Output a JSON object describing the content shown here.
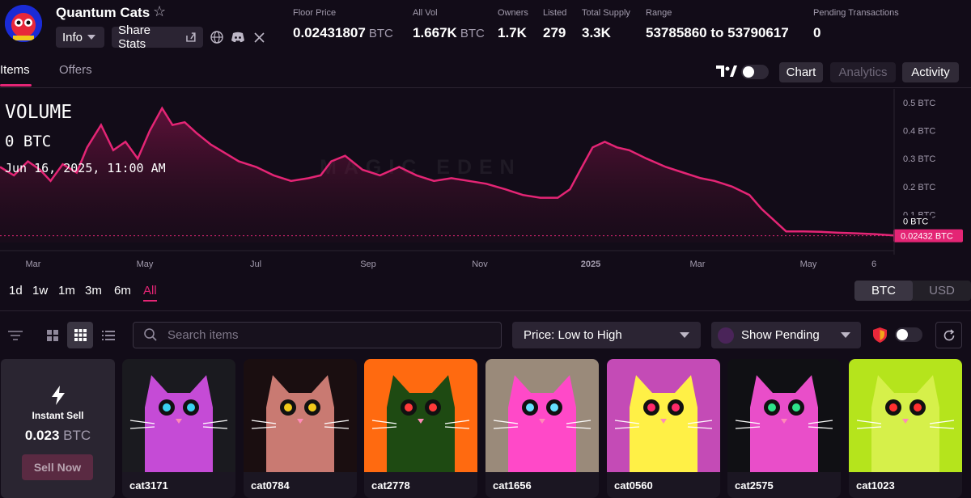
{
  "collection": {
    "name": "Quantum Cats",
    "info_label": "Info",
    "share_label": "Share Stats"
  },
  "stats": [
    {
      "label": "Floor Price",
      "value": "0.02431807",
      "unit": "BTC"
    },
    {
      "label": "All Vol",
      "value": "1.667K",
      "unit": "BTC"
    },
    {
      "label": "Owners",
      "value": "1.7K",
      "unit": ""
    },
    {
      "label": "Listed",
      "value": "279",
      "unit": ""
    },
    {
      "label": "Total Supply",
      "value": "3.3K",
      "unit": ""
    },
    {
      "label": "Range",
      "value": "53785860 to 53790617",
      "unit": ""
    },
    {
      "label": "Pending Transactions",
      "value": "0",
      "unit": ""
    }
  ],
  "tabs": {
    "items": "Items",
    "offers": "Offers"
  },
  "view_buttons": {
    "chart": "Chart",
    "analytics": "Analytics",
    "activity": "Activity"
  },
  "chart_header": {
    "title": "VOLUME",
    "value": "0 BTC",
    "date": "Jun 16, 2025, 11:00 AM"
  },
  "watermark": "MAGIC EDEN",
  "chart_data": {
    "type": "area",
    "series": [
      {
        "name": "",
        "x": [
          "2024-01-20",
          "2024-01-28",
          "2024-02-05",
          "2024-02-12",
          "2024-02-18",
          "2024-02-25",
          "2024-03-04",
          "2024-03-10",
          "2024-03-18",
          "2024-03-25",
          "2024-04-01",
          "2024-04-08",
          "2024-04-15",
          "2024-04-22",
          "2024-04-28",
          "2024-05-05",
          "2024-05-12",
          "2024-05-20",
          "2024-05-28",
          "2024-06-05",
          "2024-06-15",
          "2024-06-25",
          "2024-07-05",
          "2024-07-15",
          "2024-07-22",
          "2024-07-28",
          "2024-08-05",
          "2024-08-15",
          "2024-08-25",
          "2024-09-05",
          "2024-09-15",
          "2024-09-25",
          "2024-10-05",
          "2024-10-15",
          "2024-10-25",
          "2024-11-05",
          "2024-11-15",
          "2024-11-25",
          "2024-12-05",
          "2024-12-12",
          "2024-12-18",
          "2024-12-25",
          "2025-01-01",
          "2025-01-08",
          "2025-01-15",
          "2025-01-25",
          "2025-02-05",
          "2025-02-15",
          "2025-02-25",
          "2025-03-05",
          "2025-03-15",
          "2025-03-25",
          "2025-04-01",
          "2025-04-08",
          "2025-04-15",
          "2025-04-25",
          "2025-05-05",
          "2025-05-15",
          "2025-05-25",
          "2025-06-05",
          "2025-06-16"
        ],
        "values": [
          0.27,
          0.24,
          0.29,
          0.26,
          0.22,
          0.28,
          0.25,
          0.34,
          0.42,
          0.33,
          0.36,
          0.3,
          0.4,
          0.48,
          0.42,
          0.43,
          0.39,
          0.35,
          0.32,
          0.29,
          0.27,
          0.24,
          0.22,
          0.23,
          0.24,
          0.29,
          0.31,
          0.26,
          0.24,
          0.27,
          0.24,
          0.22,
          0.23,
          0.22,
          0.21,
          0.19,
          0.17,
          0.16,
          0.16,
          0.19,
          0.26,
          0.34,
          0.36,
          0.34,
          0.33,
          0.3,
          0.27,
          0.25,
          0.23,
          0.22,
          0.2,
          0.17,
          0.12,
          0.08,
          0.04,
          0.04,
          0.038,
          0.035,
          0.033,
          0.03,
          0.025
        ]
      }
    ],
    "xticks": [
      "Mar",
      "May",
      "Jul",
      "Sep",
      "Nov",
      "2025",
      "Mar",
      "May",
      "6"
    ],
    "yticks": [
      "0.5 BTC",
      "0.4 BTC",
      "0.3 BTC",
      "0.2 BTC",
      "0.1 BTC",
      "0 BTC"
    ],
    "ylim": [
      0,
      0.52
    ],
    "floor_label": "0.02432 BTC",
    "cursor_label": "0 BTC",
    "grid": false
  },
  "ranges": [
    "1d",
    "1w",
    "1m",
    "3m",
    "6m",
    "All"
  ],
  "currency": {
    "btc": "BTC",
    "usd": "USD"
  },
  "toolbar": {
    "search_placeholder": "Search items",
    "sort_label": "Price: Low to High",
    "pending_label": "Show Pending"
  },
  "sell": {
    "title": "Instant Sell",
    "price": "0.023",
    "unit": "BTC",
    "button": "Sell Now"
  },
  "items": [
    {
      "name": "cat3171",
      "bg": "#1a1a1f",
      "head": "#c54bd6",
      "eye": "#3ad1f0"
    },
    {
      "name": "cat0784",
      "bg": "#1a0e10",
      "head": "#c97a72",
      "eye": "#f0c81a"
    },
    {
      "name": "cat2778",
      "bg": "#ff6a10",
      "head": "#1e4a12",
      "eye": "#ff3a3a"
    },
    {
      "name": "cat1656",
      "bg": "#9a8a7a",
      "head": "#ff49c8",
      "eye": "#66e0ff"
    },
    {
      "name": "cat0560",
      "bg": "#c44bb6",
      "head": "#fff046",
      "eye": "#ff2a6a"
    },
    {
      "name": "cat2575",
      "bg": "#101014",
      "head": "#e94ec9",
      "eye": "#2ee28a"
    },
    {
      "name": "cat1023",
      "bg": "#b5e41c",
      "head": "#d6f04a",
      "eye": "#ff3030"
    }
  ],
  "colors": {
    "accent": "#e42575",
    "background": "#120c18"
  }
}
